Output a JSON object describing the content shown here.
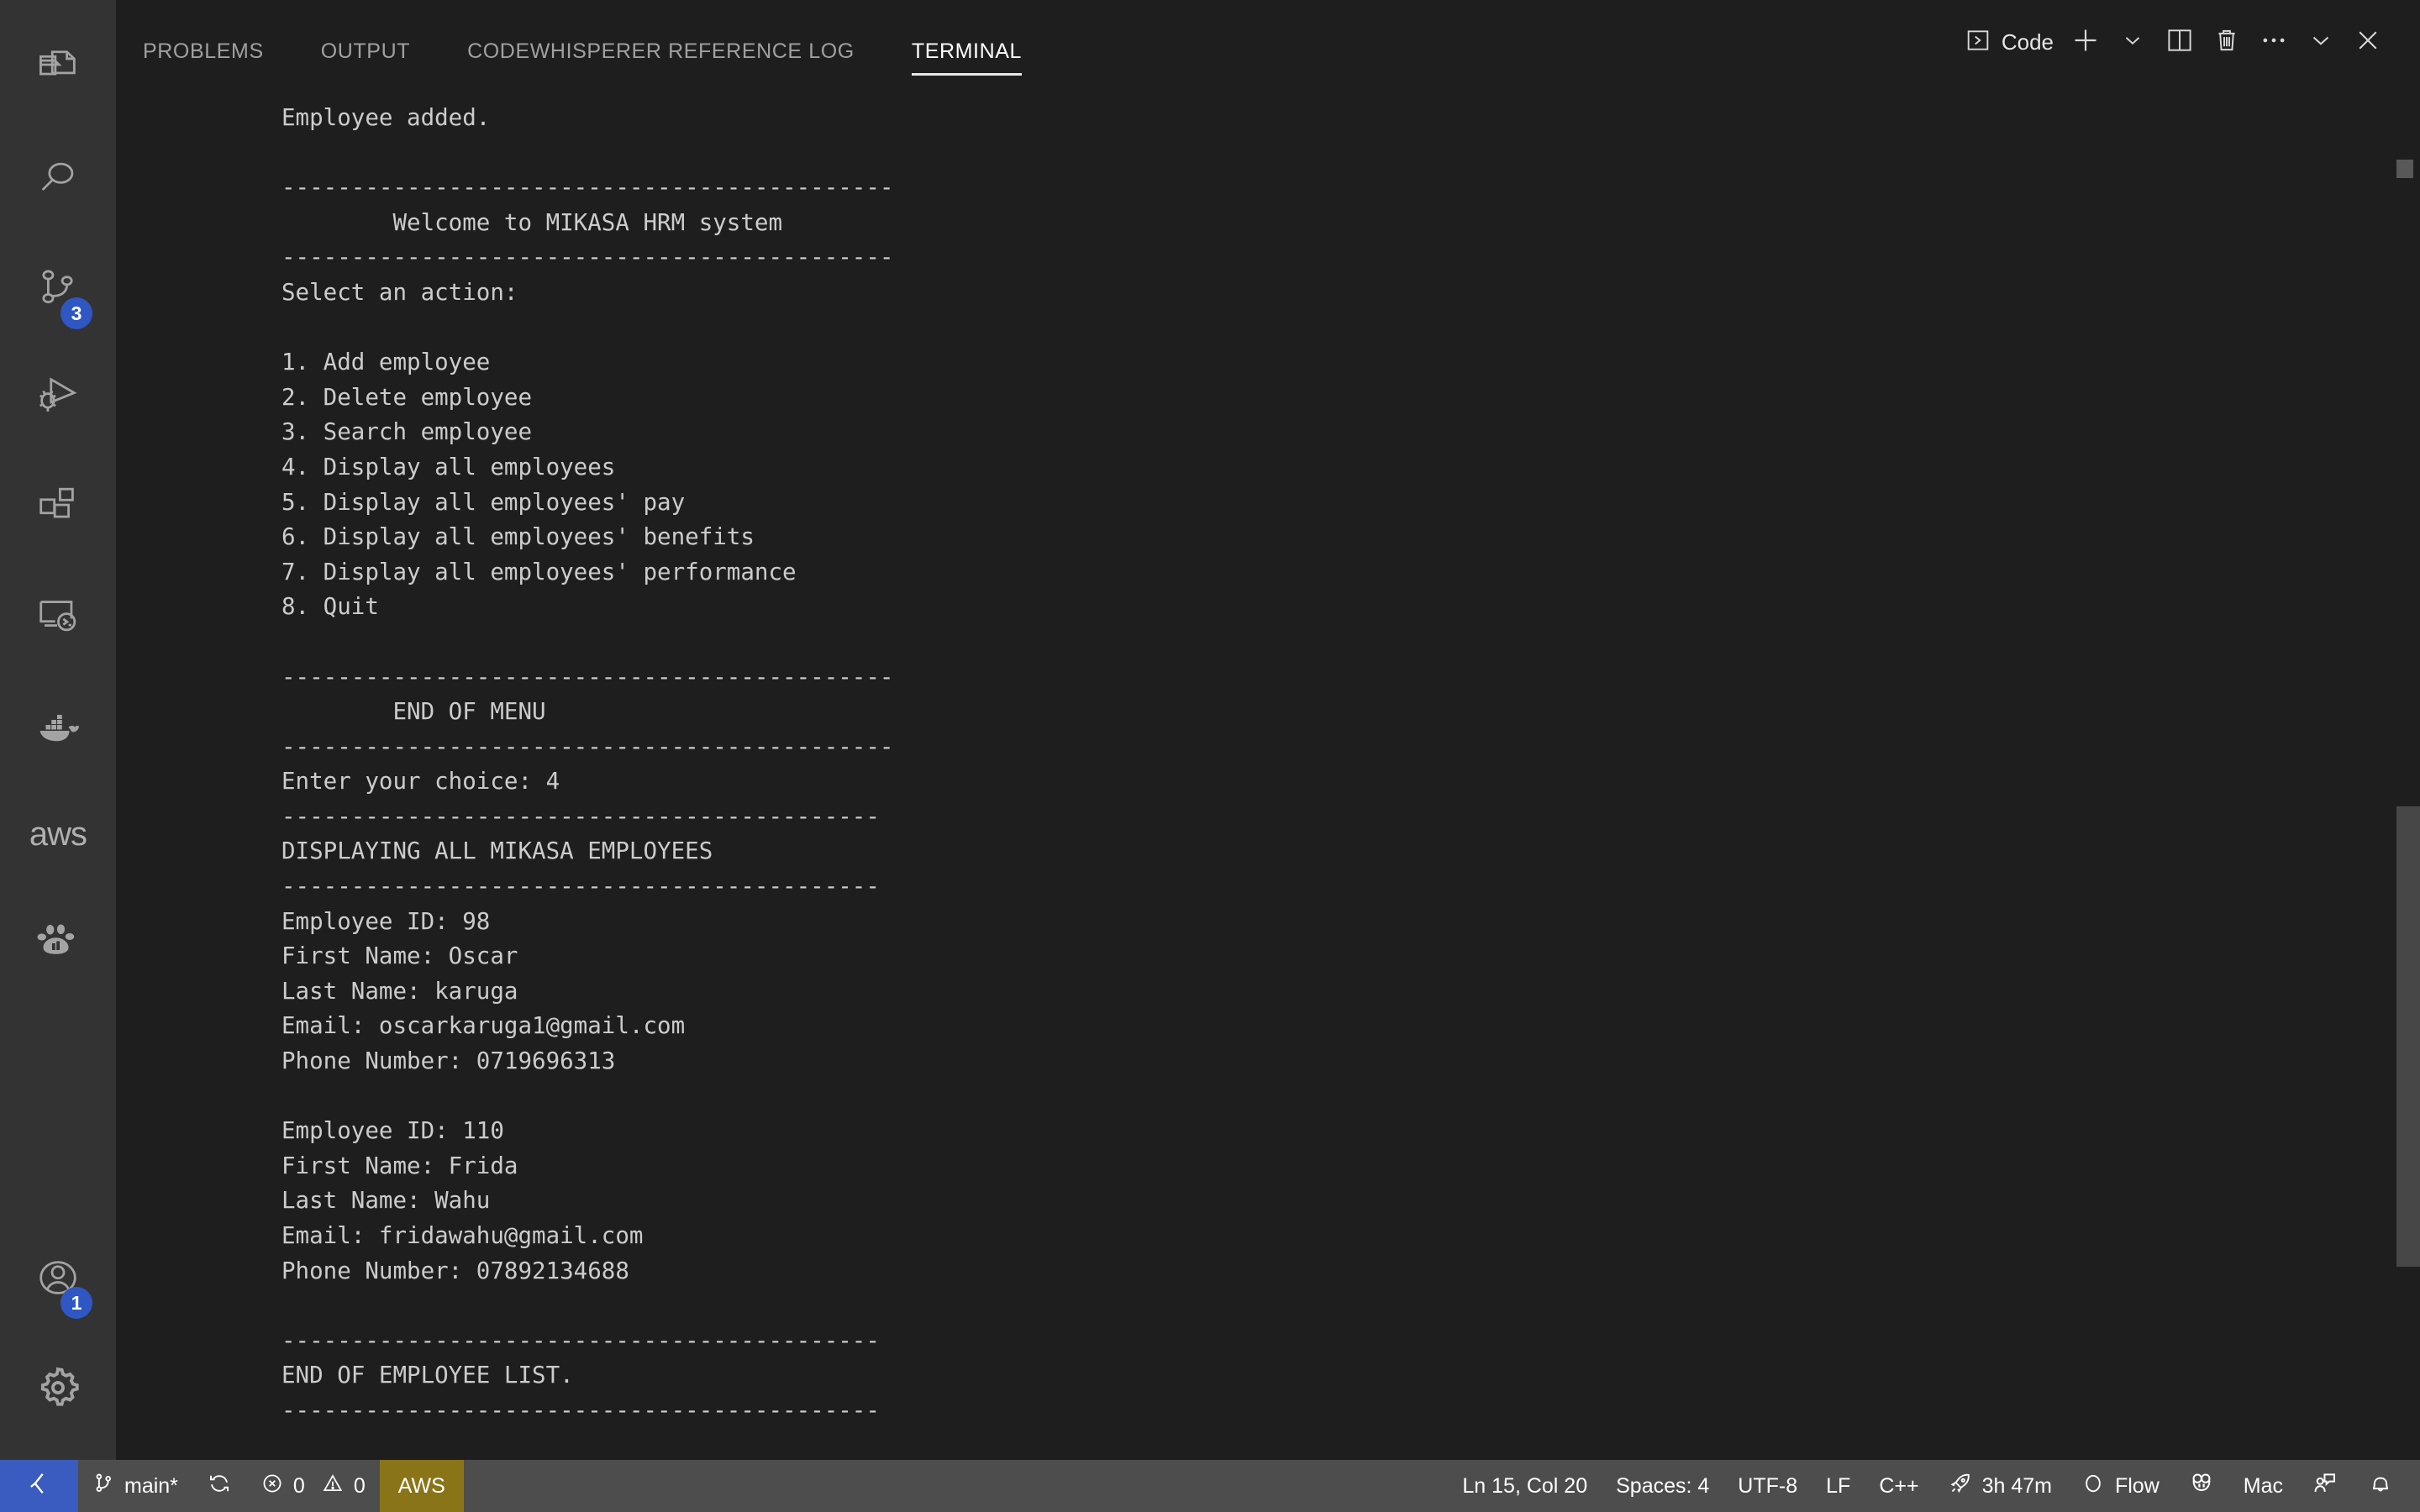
{
  "activity_bar": {
    "items": [
      {
        "name": "explorer",
        "icon": "files-icon",
        "badge": null
      },
      {
        "name": "search",
        "icon": "search-icon",
        "badge": null
      },
      {
        "name": "source-control",
        "icon": "source-control-icon",
        "badge": "3"
      },
      {
        "name": "run-debug",
        "icon": "run-and-debug-icon",
        "badge": null
      },
      {
        "name": "extensions",
        "icon": "extensions-icon",
        "badge": null
      },
      {
        "name": "remote-explorer",
        "icon": "remote-explorer-icon",
        "badge": null
      },
      {
        "name": "docker",
        "icon": "docker-whale-icon",
        "badge": null
      },
      {
        "name": "aws-toolkit",
        "icon": "aws-logo",
        "badge": null,
        "label": "aws"
      },
      {
        "name": "baidu-comate",
        "icon": "paw-print-icon",
        "badge": null
      }
    ],
    "bottom_items": [
      {
        "name": "accounts",
        "icon": "account-icon",
        "badge": "1"
      },
      {
        "name": "settings",
        "icon": "gear-icon",
        "badge": null
      }
    ]
  },
  "panel": {
    "tabs": [
      {
        "label": "PROBLEMS",
        "active": false
      },
      {
        "label": "OUTPUT",
        "active": false
      },
      {
        "label": "CODEWHISPERER REFERENCE LOG",
        "active": false
      },
      {
        "label": "TERMINAL",
        "active": true
      }
    ],
    "actions": {
      "shell_label": "Code",
      "shell_icon": "terminal-chevron-icon",
      "new_terminal_icon": "plus-icon",
      "new_terminal_dropdown_icon": "chevron-down-icon",
      "split_icon": "split-editor-icon",
      "kill_icon": "trash-icon",
      "views_icon": "ellipsis-icon",
      "hide_icon": "chevron-down-icon",
      "close_icon": "close-icon"
    }
  },
  "terminal": {
    "lines": [
      "Employee added.",
      "",
      "--------------------------------------------",
      "        Welcome to MIKASA HRM system",
      "--------------------------------------------",
      "Select an action:",
      "",
      "1. Add employee",
      "2. Delete employee",
      "3. Search employee",
      "4. Display all employees",
      "5. Display all employees' pay",
      "6. Display all employees' benefits",
      "7. Display all employees' performance",
      "8. Quit",
      "",
      "--------------------------------------------",
      "        END OF MENU",
      "--------------------------------------------",
      "Enter your choice: 4",
      "-------------------------------------------",
      "DISPLAYING ALL MIKASA EMPLOYEES",
      "-------------------------------------------",
      "Employee ID: 98",
      "First Name: Oscar",
      "Last Name: karuga",
      "Email: oscarkaruga1@gmail.com",
      "Phone Number: 0719696313",
      "",
      "Employee ID: 110",
      "First Name: Frida",
      "Last Name: Wahu",
      "Email: fridawahu@gmail.com",
      "Phone Number: 07892134688",
      "",
      "-------------------------------------------",
      "END OF EMPLOYEE LIST.",
      "-------------------------------------------"
    ]
  },
  "status_bar": {
    "remote_icon": "remote-window-icon",
    "branch_icon": "source-control-branch-icon",
    "branch": "main*",
    "sync_icon": "sync-icon",
    "errors_icon": "error-circle-icon",
    "errors": "0",
    "warnings_icon": "warning-triangle-icon",
    "warnings": "0",
    "aws": "AWS",
    "cursor_position": "Ln 15, Col 20",
    "indentation": "Spaces: 4",
    "encoding": "UTF-8",
    "eol": "LF",
    "language": "C++",
    "wakatime_icon": "rocket-icon",
    "wakatime": "3h 47m",
    "flow_icon": "circle-icon",
    "flow": "Flow",
    "codewhisperer_icon": "codewhisperer-icon",
    "platform": "Mac",
    "feedback_icon": "account-feedback-icon",
    "bell_icon": "bell-icon"
  },
  "colors": {
    "activity_bar_bg": "#333333",
    "panel_bg": "#1e1e1e",
    "status_bar_bg": "#4d4d4d",
    "remote_blue": "#3a5bbf",
    "aws_gold": "#8a7418",
    "badge_blue": "#2f57c4",
    "terminal_fg": "#cccccc"
  }
}
